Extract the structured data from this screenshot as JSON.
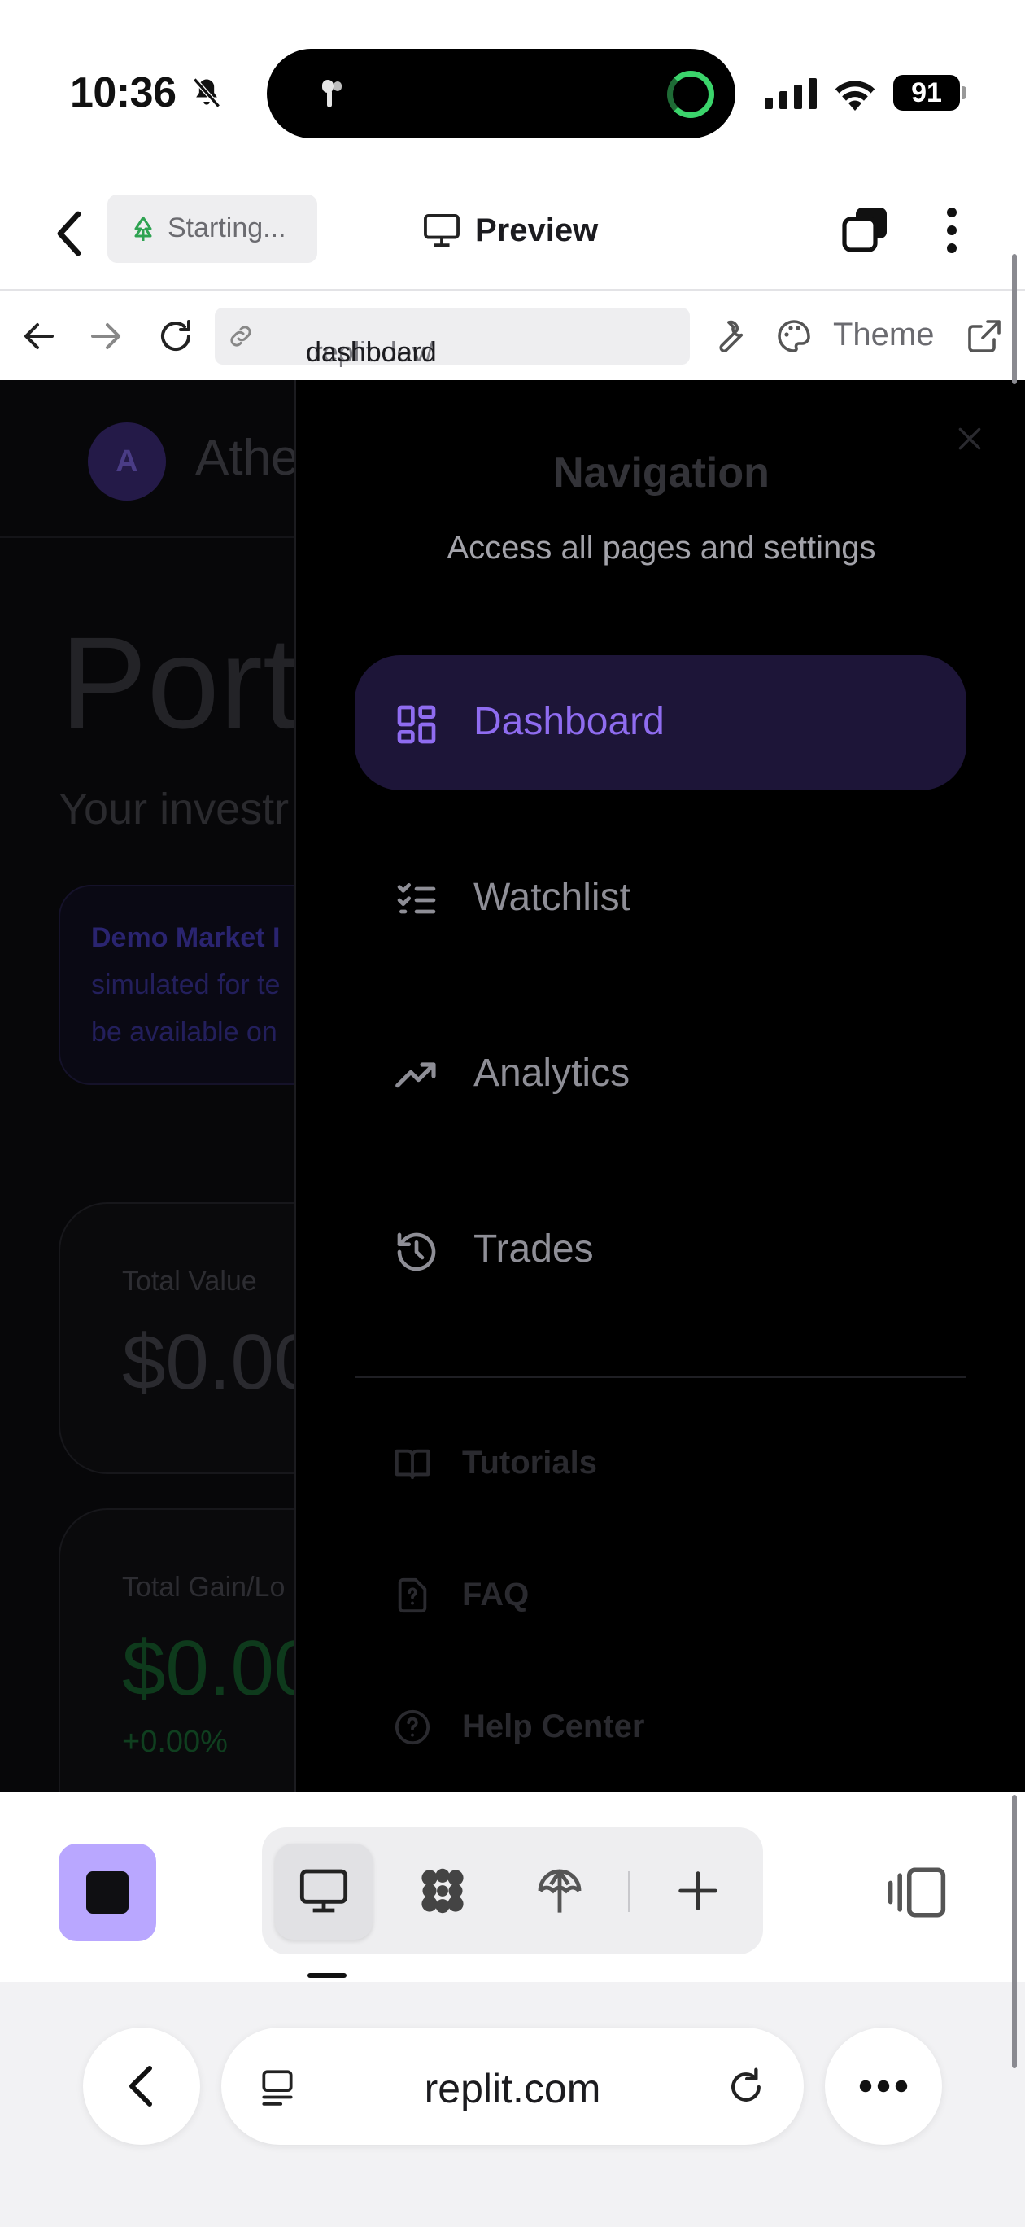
{
  "status_bar": {
    "time": "10:36",
    "battery": "91"
  },
  "preview_header": {
    "status_chip": "Starting...",
    "title": "Preview"
  },
  "url_bar": {
    "url_prefix": ".replit.dev/",
    "url_path": "dashboard",
    "theme_label": "Theme"
  },
  "app": {
    "avatar_letter": "A",
    "app_name": "Athe",
    "page_title": "Portf",
    "subtitle": "Your investr",
    "demo_notice": {
      "line1": "Demo Market I",
      "line2": "simulated for te",
      "line3": "be available on"
    },
    "total_value": {
      "label": "Total Value",
      "value": "$0.00"
    },
    "total_gain": {
      "label": "Total Gain/Lo",
      "value": "$0.00",
      "change": "+0.00%"
    }
  },
  "drawer": {
    "title": "Navigation",
    "subtitle": "Access all pages and settings",
    "items": [
      {
        "label": "Dashboard",
        "icon": "dashboard-grid-icon",
        "active": true
      },
      {
        "label": "Watchlist",
        "icon": "checklist-icon",
        "active": false
      },
      {
        "label": "Analytics",
        "icon": "trending-up-icon",
        "active": false
      },
      {
        "label": "Trades",
        "icon": "history-icon",
        "active": false
      }
    ],
    "help": [
      {
        "label": "Tutorials",
        "icon": "book-icon"
      },
      {
        "label": "FAQ",
        "icon": "faq-icon"
      },
      {
        "label": "Help Center",
        "icon": "help-circle-icon"
      }
    ]
  },
  "safari": {
    "address": "replit.com"
  },
  "colors": {
    "accent": "#8f6cf0",
    "active_bg": "#1d1538",
    "stop_button": "#b9a7ff"
  }
}
